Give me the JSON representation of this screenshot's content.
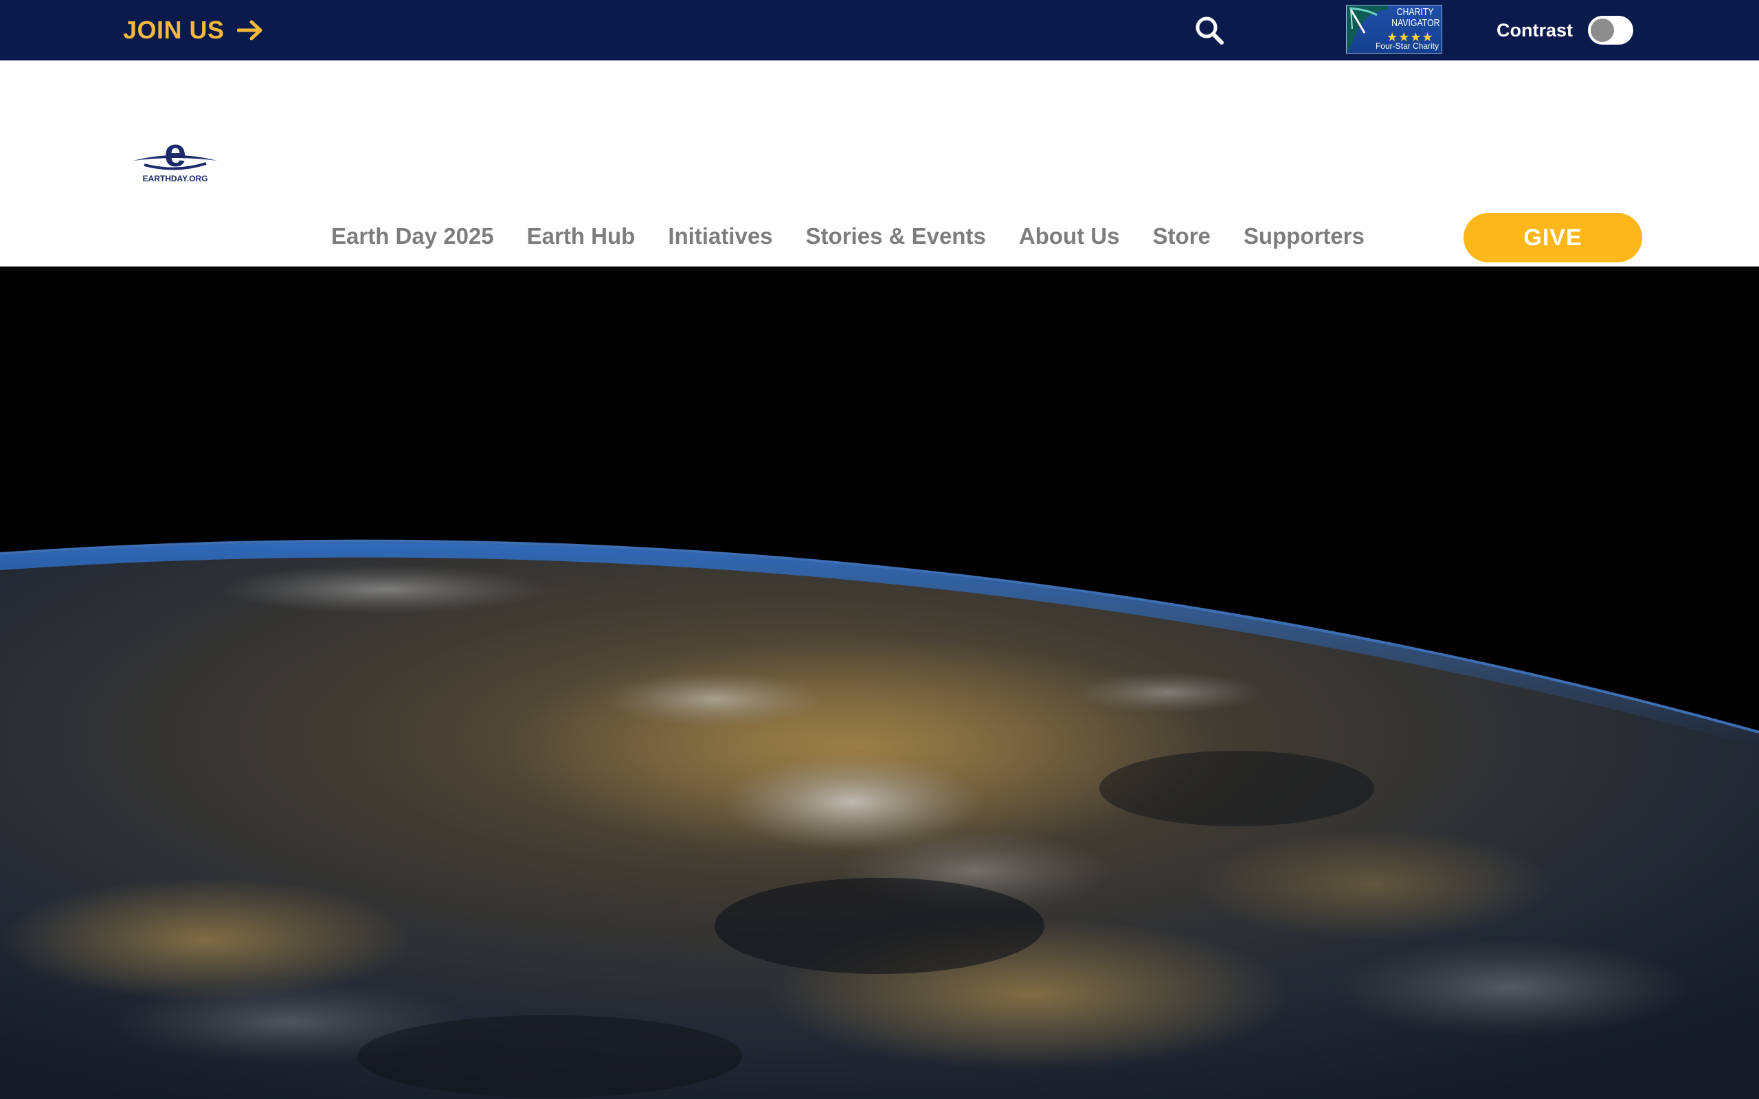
{
  "topbar": {
    "join_label": "JOIN US",
    "join_icon": "arrow-right-icon",
    "search_icon": "search-icon",
    "charity_badge": {
      "line1": "CHARITY",
      "line2": "NAVIGATOR",
      "stars": "★★★★",
      "caption": "Four-Star Charity"
    },
    "contrast_label": "Contrast",
    "contrast_on": false
  },
  "nav": {
    "logo_text": "EARTHDAY.ORG",
    "items": [
      {
        "label": "Earth Day 2025"
      },
      {
        "label": "Earth Hub"
      },
      {
        "label": "Initiatives"
      },
      {
        "label": "Stories & Events"
      },
      {
        "label": "About Us"
      },
      {
        "label": "Store"
      },
      {
        "label": "Supporters"
      }
    ],
    "give_label": "GIVE"
  },
  "colors": {
    "topbar_bg": "#0b1a4d",
    "join_accent": "#f4b83a",
    "give_bg": "#fdb71a",
    "nav_text": "#7d7d7d"
  }
}
